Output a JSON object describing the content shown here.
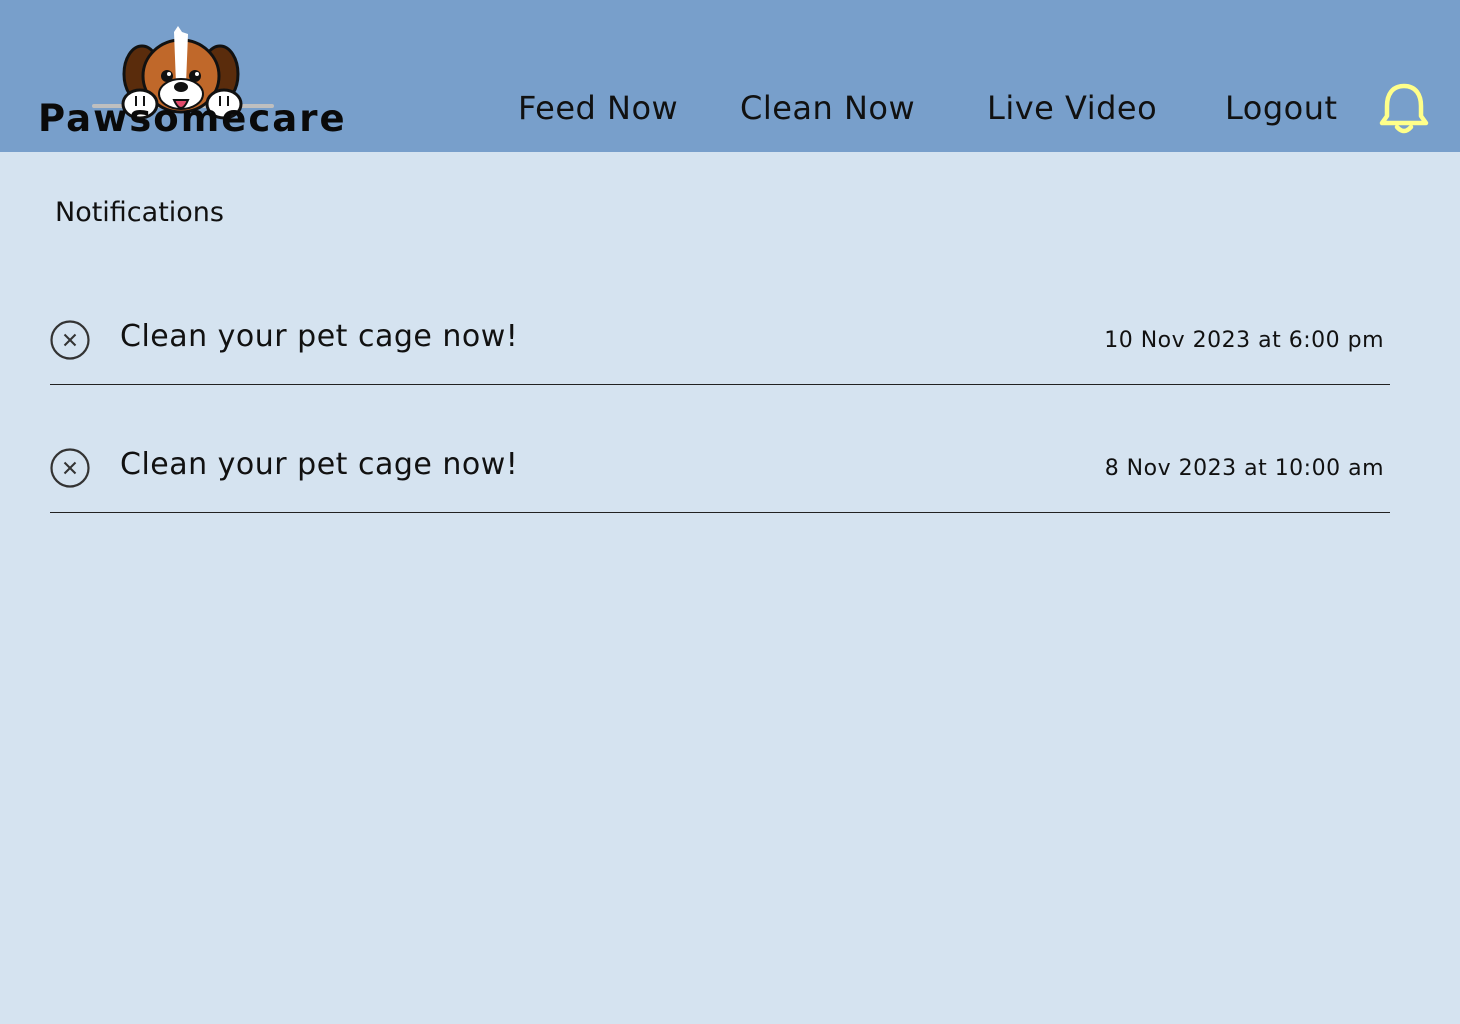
{
  "brand": {
    "name": "Pawsomecare"
  },
  "nav": {
    "items": [
      {
        "label": "Feed Now"
      },
      {
        "label": "Clean Now"
      },
      {
        "label": "Live Video"
      },
      {
        "label": "Logout"
      }
    ],
    "bell_icon": "bell-icon",
    "bell_color": "#ffff8a"
  },
  "notifications": {
    "title": "Notifications",
    "items": [
      {
        "message": "Clean your pet cage now!",
        "time": "10 Nov 2023 at 6:00 pm",
        "icon": "close-circle-icon"
      },
      {
        "message": "Clean your pet cage now!",
        "time": "8 Nov 2023 at 10:00 am",
        "icon": "close-circle-icon"
      }
    ]
  },
  "colors": {
    "header_bg": "#789fcb",
    "page_bg": "#d5e3f0",
    "text": "#111111"
  }
}
